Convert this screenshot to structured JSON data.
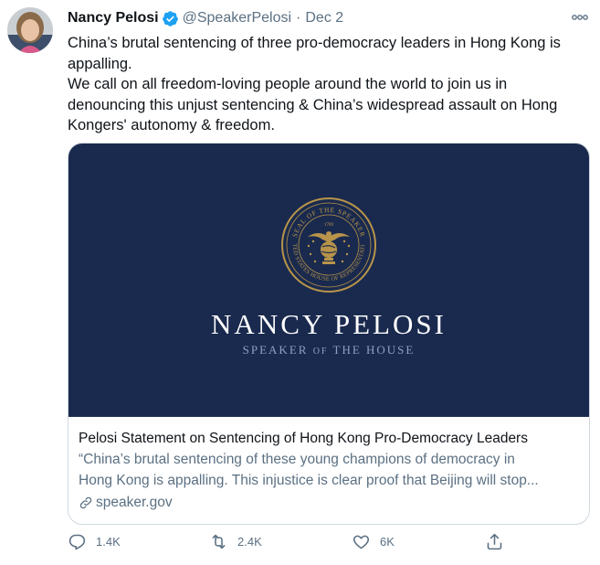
{
  "tweet": {
    "author_name": "Nancy Pelosi",
    "handle": "@SpeakerPelosi",
    "separator": "·",
    "date": "Dec 2",
    "text_lines": [
      "China’s brutal sentencing of three pro-democracy leaders in Hong Kong is",
      "appalling.",
      "We call on all freedom-loving people around the world to join us in",
      "denouncing this unjust sentencing & China’s widespread assault on Hong",
      "Kongers' autonomy & freedom."
    ]
  },
  "card": {
    "image_seal_top": "SEAL OF THE SPEAKER",
    "image_seal_year": "1789",
    "image_seal_bottom": "UNITED STATES HOUSE OF REPRESENTATIVES",
    "image_title": "NANCY PELOSI",
    "image_subtitle_a": "SPEAKER",
    "image_subtitle_of": "OF",
    "image_subtitle_b": "THE HOUSE",
    "title": "Pelosi Statement on Sentencing of Hong Kong Pro-Democracy Leaders",
    "description_lines": [
      "“China’s brutal sentencing of these young champions of democracy in",
      "Hong Kong is appalling. This injustice is clear proof that Beijing will stop..."
    ],
    "domain": "speaker.gov"
  },
  "actions": {
    "replies": "1.4K",
    "retweets": "2.4K",
    "likes": "6K"
  },
  "colors": {
    "verified_badge": "#1da1f2",
    "card_background": "#1a2a4e",
    "seal_gold": "#b8944a",
    "secondary_text": "#5b7083",
    "border": "#cfd9de"
  },
  "icons": {
    "verified": "verified-badge-icon",
    "more": "more-options-icon",
    "reply": "reply-icon",
    "retweet": "retweet-icon",
    "like": "heart-icon",
    "share": "share-icon",
    "link": "link-icon"
  }
}
